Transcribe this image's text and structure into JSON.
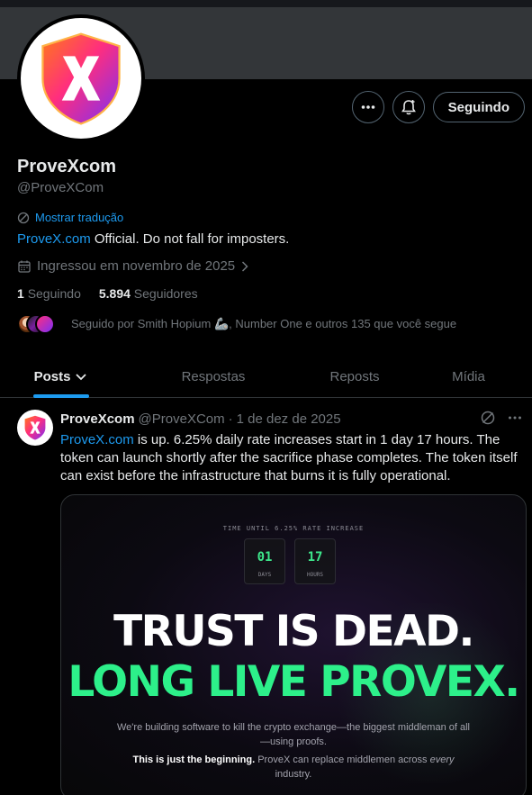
{
  "profile": {
    "name": "ProveXcom",
    "handle": "@ProveXCom",
    "translate_label": "Mostrar tradução",
    "bio_link": "ProveX.com",
    "bio_text": " Official. Do not fall for imposters.",
    "joined": "Ingressou em novembro de 2025",
    "following_count": "1",
    "following_label": "Seguindo",
    "followers_count": "5.894",
    "followers_label": "Seguidores",
    "followed_by": "Seguido por Smith Hopium 🦾, Number One e outros 135 que você segue"
  },
  "actions": {
    "more_icon": "more-icon",
    "notify_icon": "notification-bell-icon",
    "follow_label": "Seguindo"
  },
  "tabs": [
    {
      "label": "Posts"
    },
    {
      "label": "Respostas"
    },
    {
      "label": "Reposts"
    },
    {
      "label": "Mídia"
    }
  ],
  "post": {
    "name": "ProveXcom",
    "handle": "@ProveXCom",
    "separator": "·",
    "date": "1 de dez de 2025",
    "text_link": "ProveX.com",
    "text": " is up. 6.25% daily rate increases start in 1 day 17 hours. The token can launch shortly after the sacrifice phase completes. The token itself can exist before the infrastructure that burns it is fully operational.",
    "media": {
      "timer_label": "TIME UNTIL 6.25% RATE INCREASE",
      "days_value": "01",
      "days_unit": "DAYS",
      "hours_value": "17",
      "hours_unit": "HOURS",
      "headline_1": "TRUST IS DEAD.",
      "headline_2": "LONG LIVE PROVEX.",
      "sub_1": "We're building software to kill the crypto exchange—the biggest middleman of all—using proofs.",
      "sub_2_bold": "This is just the beginning.",
      "sub_2_pre": " ProveX can replace middlemen across ",
      "sub_2_em": "every",
      "sub_2_post": " industry."
    }
  },
  "colors": {
    "accent": "#1d9bf0",
    "green": "#2df08a",
    "muted": "#71767b"
  }
}
